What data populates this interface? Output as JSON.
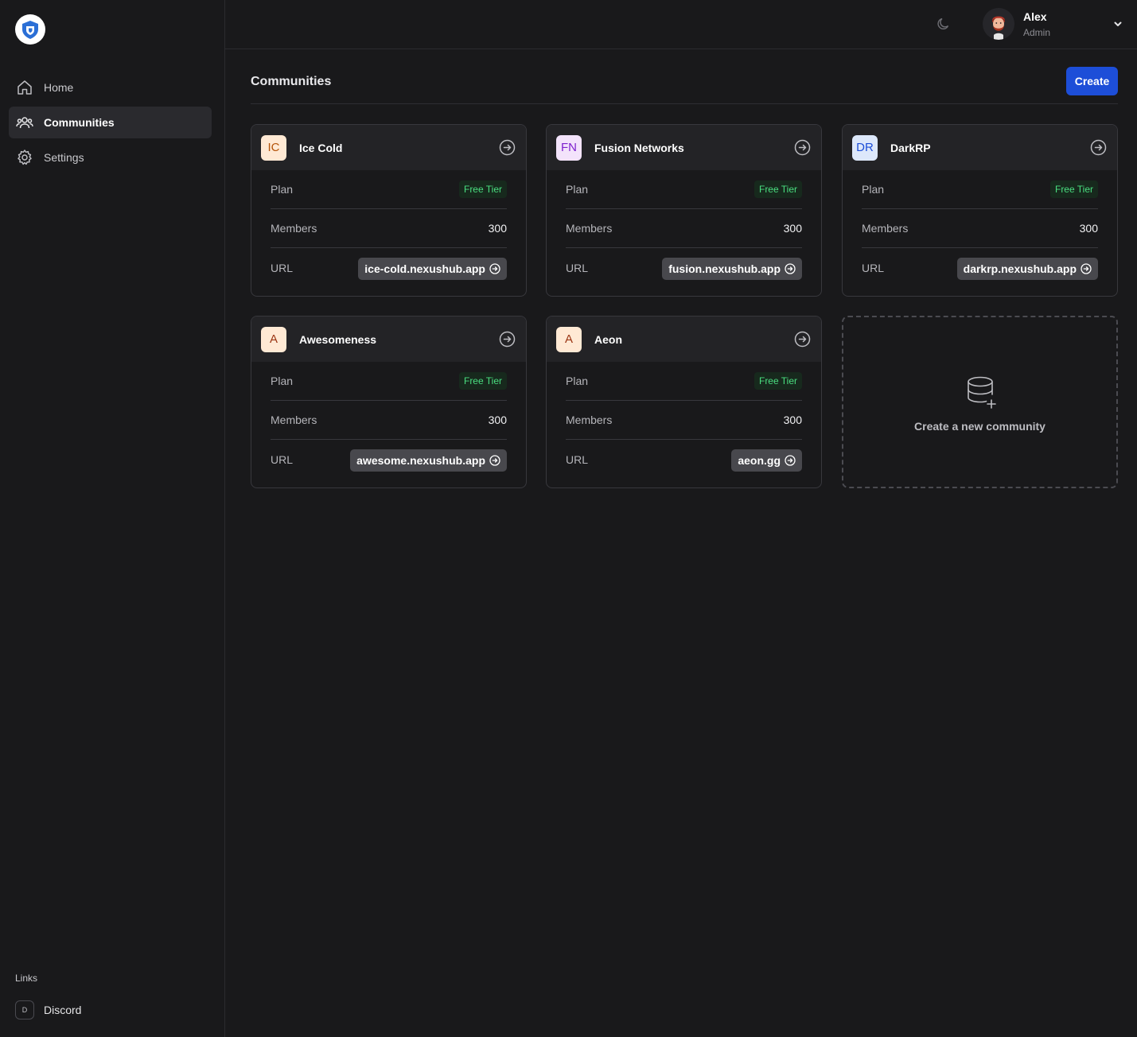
{
  "sidebar": {
    "nav": [
      {
        "label": "Home",
        "icon": "home-icon"
      },
      {
        "label": "Communities",
        "icon": "users-icon",
        "active": true
      },
      {
        "label": "Settings",
        "icon": "gear-icon"
      }
    ],
    "links_title": "Links",
    "links": [
      {
        "badge": "D",
        "label": "Discord"
      }
    ]
  },
  "topbar": {
    "user": {
      "name": "Alex",
      "role": "Admin"
    }
  },
  "main": {
    "title": "Communities",
    "create_label": "Create",
    "plan_label": "Plan",
    "members_label": "Members",
    "url_label": "URL",
    "new_community_label": "Create a new community",
    "communities": [
      {
        "initials": "IC",
        "name": "Ice Cold",
        "plan": "Free Tier",
        "members": "300",
        "url": "ice-cold.nexushub.app",
        "initials_bg": "#ffe9d4",
        "initials_fg": "#b45309"
      },
      {
        "initials": "FN",
        "name": "Fusion Networks",
        "plan": "Free Tier",
        "members": "300",
        "url": "fusion.nexushub.app",
        "initials_bg": "#f3e3fb",
        "initials_fg": "#7e22ce"
      },
      {
        "initials": "DR",
        "name": "DarkRP",
        "plan": "Free Tier",
        "members": "300",
        "url": "darkrp.nexushub.app",
        "initials_bg": "#dde8fb",
        "initials_fg": "#1d4ed8"
      },
      {
        "initials": "A",
        "name": "Awesomeness",
        "plan": "Free Tier",
        "members": "300",
        "url": "awesome.nexushub.app",
        "initials_bg": "#ffe9d4",
        "initials_fg": "#9a3412"
      },
      {
        "initials": "A",
        "name": "Aeon",
        "plan": "Free Tier",
        "members": "300",
        "url": "aeon.gg",
        "initials_bg": "#ffe9d4",
        "initials_fg": "#9a3412"
      }
    ]
  },
  "colors": {
    "accent": "#1d4ed8",
    "badge_text": "#4ade80",
    "background": "#19191b"
  }
}
